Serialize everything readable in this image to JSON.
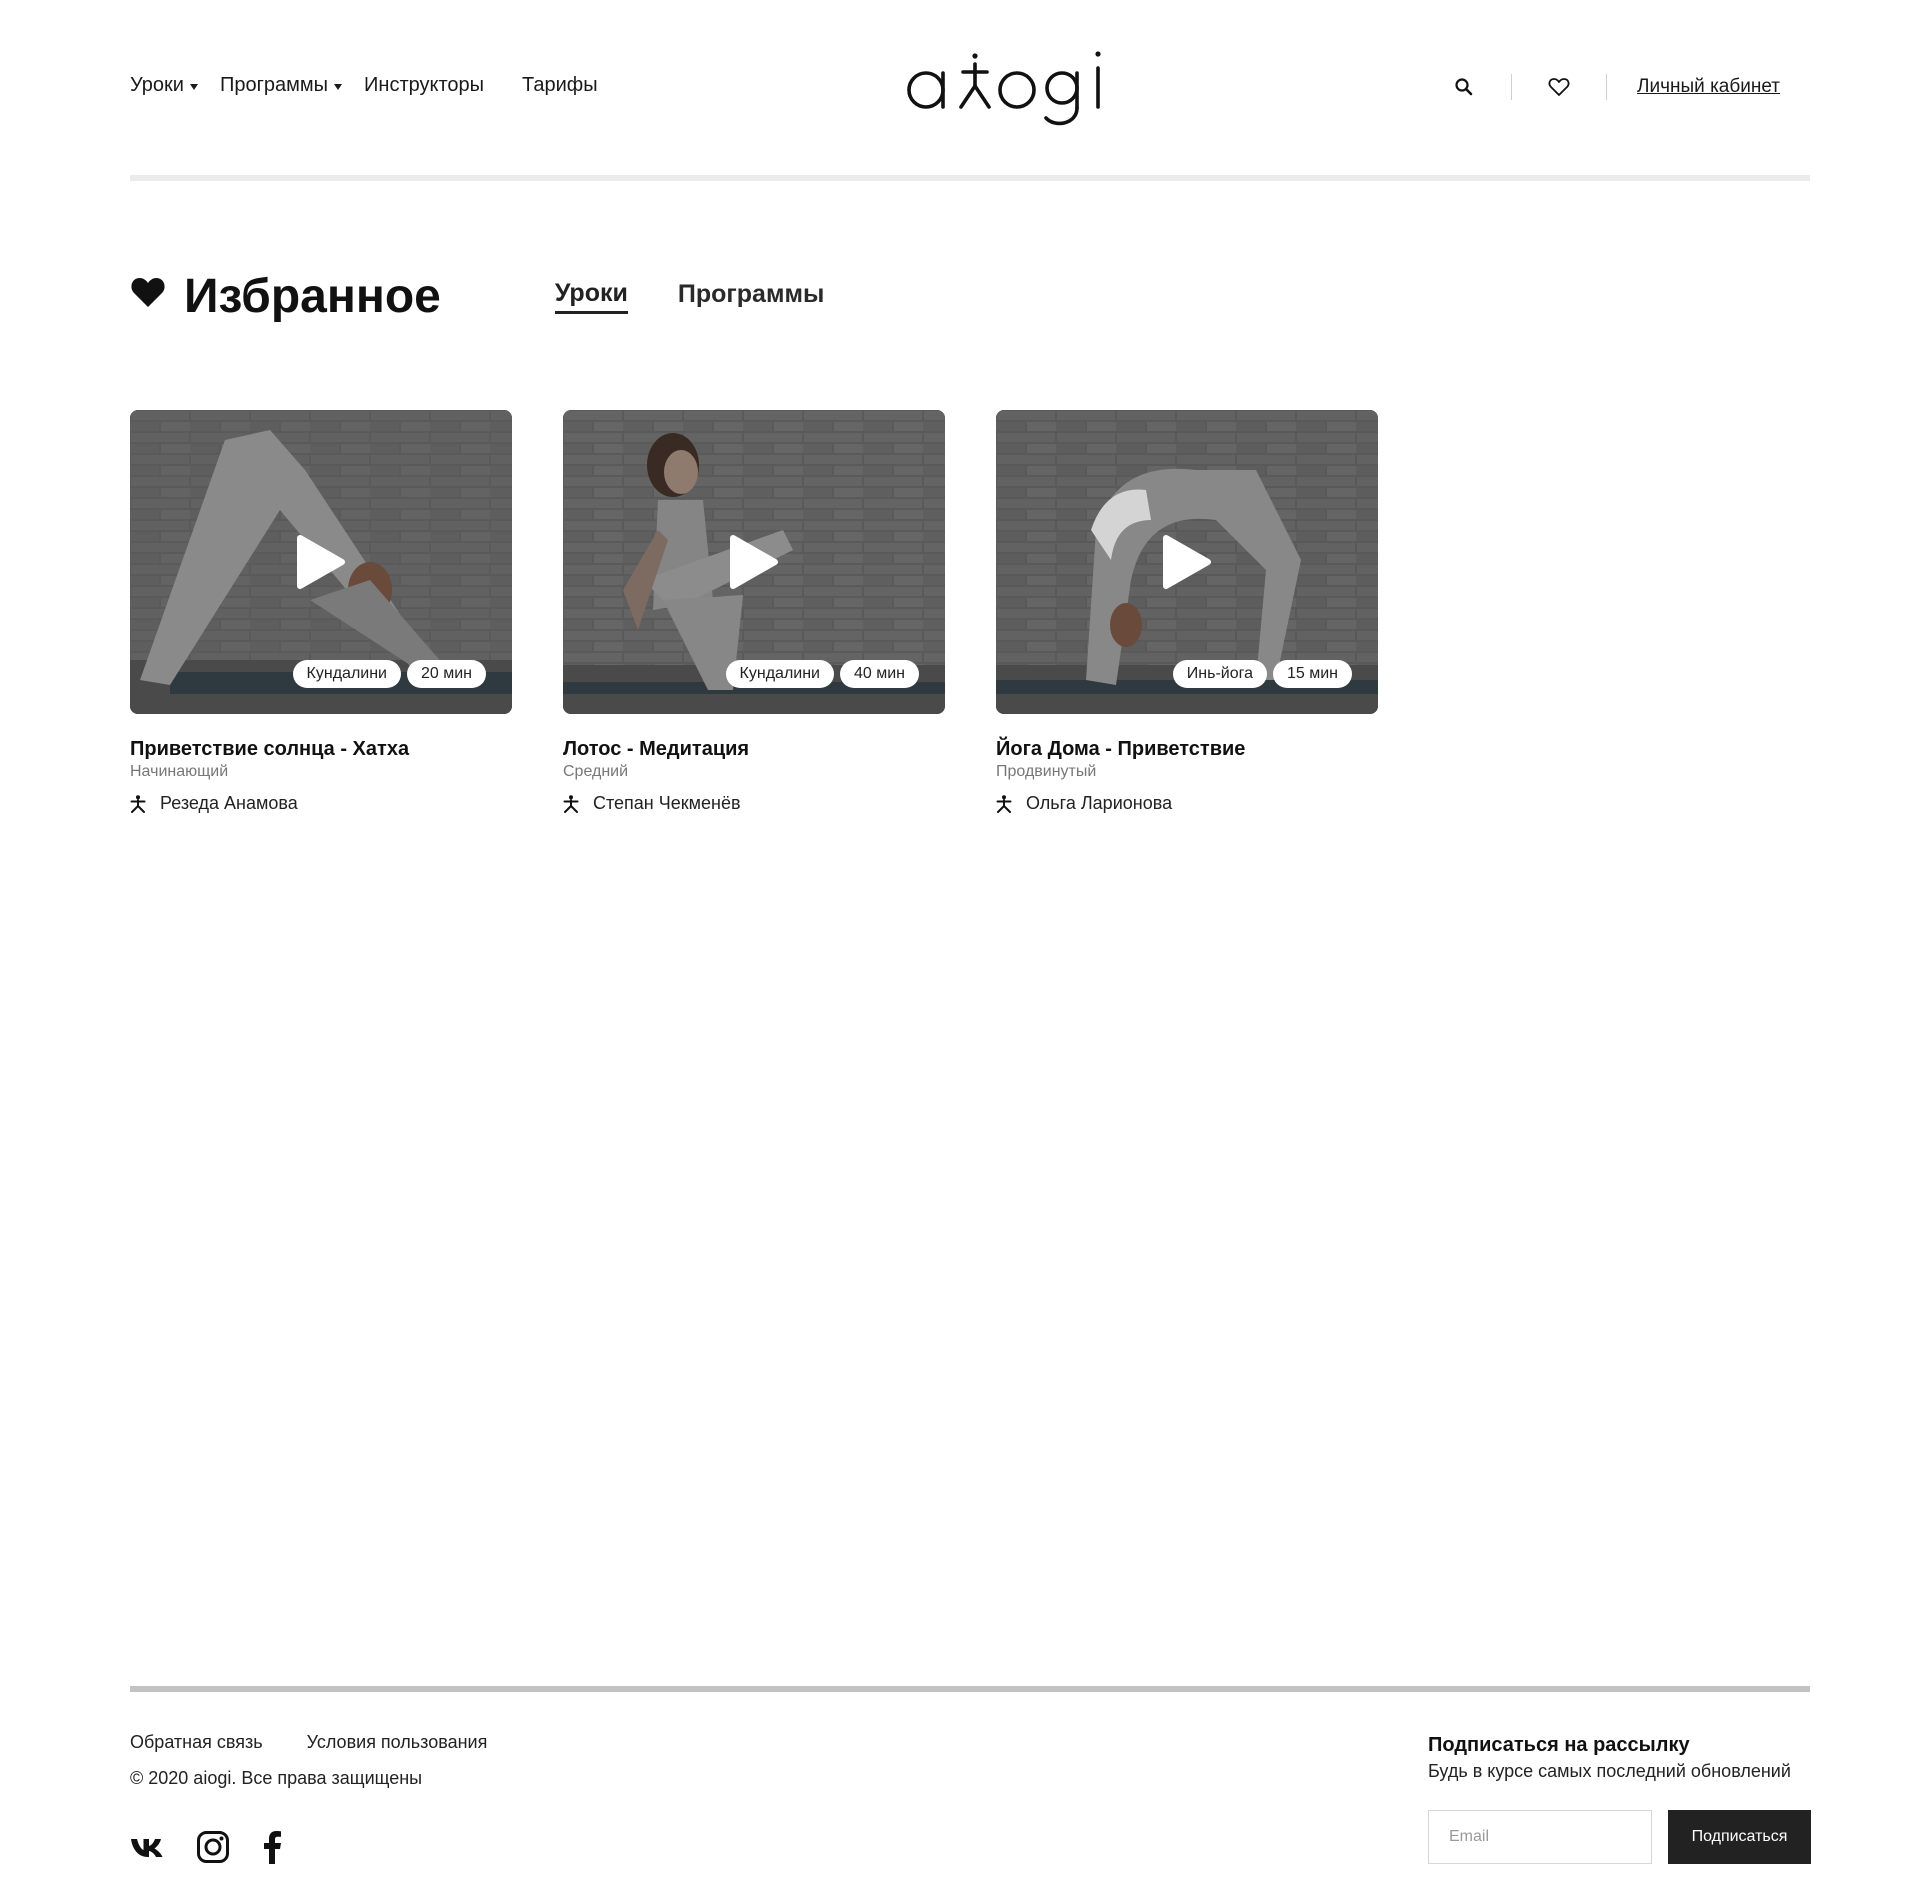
{
  "header": {
    "logo_text": "aiogi",
    "nav": [
      {
        "label": "Уроки",
        "has_dropdown": true
      },
      {
        "label": "Программы",
        "has_dropdown": true
      },
      {
        "label": "Инструкторы",
        "has_dropdown": false
      },
      {
        "label": "Тарифы",
        "has_dropdown": false
      }
    ],
    "search_icon": "search-icon",
    "favorites_icon": "heart-outline-icon",
    "account_label": "Личный кабинет"
  },
  "page": {
    "title": "Избранное",
    "title_icon": "heart-filled-icon",
    "tabs": [
      {
        "label": "Уроки",
        "active": true
      },
      {
        "label": "Программы",
        "active": false
      }
    ]
  },
  "cards": [
    {
      "title": "Приветствие солнца - Хатха",
      "level": "Начинающий",
      "instructor": "Резеда Анамова",
      "style_tag": "Кундалини",
      "duration": "20 мин"
    },
    {
      "title": "Лотос - Медитация",
      "level": "Средний",
      "instructor": "Степан Чекменёв",
      "style_tag": "Кундалини",
      "duration": "40 мин"
    },
    {
      "title": "Йога Дома - Приветствие",
      "level": "Продвинутый",
      "instructor": "Ольга Ларионова",
      "style_tag": "Инь-йога",
      "duration": "15 мин"
    }
  ],
  "footer": {
    "links": [
      "Обратная связь",
      "Условия пользования"
    ],
    "copyright": "© 2020 aiogi. Все права защищены",
    "socials": [
      "vk-icon",
      "instagram-icon",
      "facebook-icon"
    ],
    "subscribe": {
      "title": "Подписаться на рассылку",
      "subtitle": "Будь в курсе самых последний обновлений",
      "email_placeholder": "Email",
      "button_label": "Подписаться"
    }
  },
  "colors": {
    "text": "#111111",
    "muted": "#777777",
    "divider_top": "#ebebeb",
    "divider_bottom": "#c2c2c2",
    "button_bg": "#222222"
  }
}
